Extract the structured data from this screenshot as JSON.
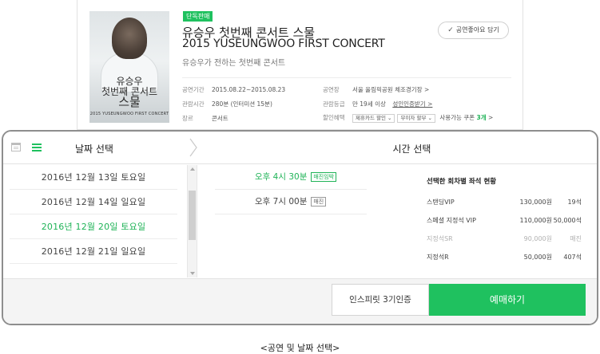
{
  "colors": {
    "accent": "#1fc15f",
    "panel_border": "#8e8e8e",
    "muted": "#b0b0b0"
  },
  "show": {
    "badge": "단독판매",
    "title_ko": "유승우 첫번째 콘서트 스물",
    "title_en": "2015 YUSEUNGWOO FIRST CONCERT",
    "subtitle": "유승우가 전하는 첫번째 콘서트",
    "favorite_label": "공연좋아요 담기",
    "poster": {
      "title_line1": "유승우",
      "title_line2": "첫번째 콘서트",
      "title_line3": "스물",
      "caption": "2015 YUSEUNGWOO FIRST CONCERT",
      "subcaption": ""
    },
    "info": {
      "period_key": "공연기간",
      "period_val": "2015.08.22~2015.08.23",
      "runtime_key": "관람시간",
      "runtime_val": "280분 (인터미션 15분)",
      "genre_key": "장르",
      "genre_val": "콘서트",
      "venue_key": "공연장",
      "venue_val": "서울 올림픽공원 체조경기장 >",
      "rating_key": "관람등급",
      "rating_val": "만 19세 이상",
      "rating_link": "성인인증받기 >",
      "discount_key": "할인혜택",
      "discount_sel1": "제휴카드 할인 ⌄",
      "discount_sel2": "무이자 할부 ⌄",
      "coupon_text": "사용가능 쿠폰",
      "coupon_count": "3개",
      "coupon_arrow": ">"
    }
  },
  "panel": {
    "head_date": "날짜 선택",
    "head_time": "시간 선택",
    "calendar_icon": "calendar-icon",
    "menu_icon": "list-icon",
    "dates": [
      {
        "label": "2016년 12월 13일  토요일",
        "selected": false
      },
      {
        "label": "2016년 12월 14일  일요일",
        "selected": false
      },
      {
        "label": "2016년 12월 20일  토요일",
        "selected": true
      },
      {
        "label": "2016년 12월 21일  일요일",
        "selected": false
      }
    ],
    "times": [
      {
        "label": "오후 4시 30분",
        "tag": "매진임박",
        "selected": true
      },
      {
        "label": "오후 7시 00분",
        "tag": "매진",
        "selected": false
      }
    ],
    "seats_title": "선택한 회차별 좌석 현황",
    "seats": [
      {
        "name": "스탠딩VIP",
        "price": "130,000원",
        "count": "19석",
        "soldout": false
      },
      {
        "name": "스페셜 지정석 VIP",
        "price": "110,000원",
        "count": "50,000석",
        "soldout": false
      },
      {
        "name": "지정석SR",
        "price": "90,000원",
        "count": "매진",
        "soldout": true
      },
      {
        "name": "지정석R",
        "price": "50,000원",
        "count": "407석",
        "soldout": false
      }
    ],
    "inspirit_button": "인스피릿 3기인증",
    "book_button": "예매하기"
  },
  "caption": "<공연 및 날짜 선택>"
}
